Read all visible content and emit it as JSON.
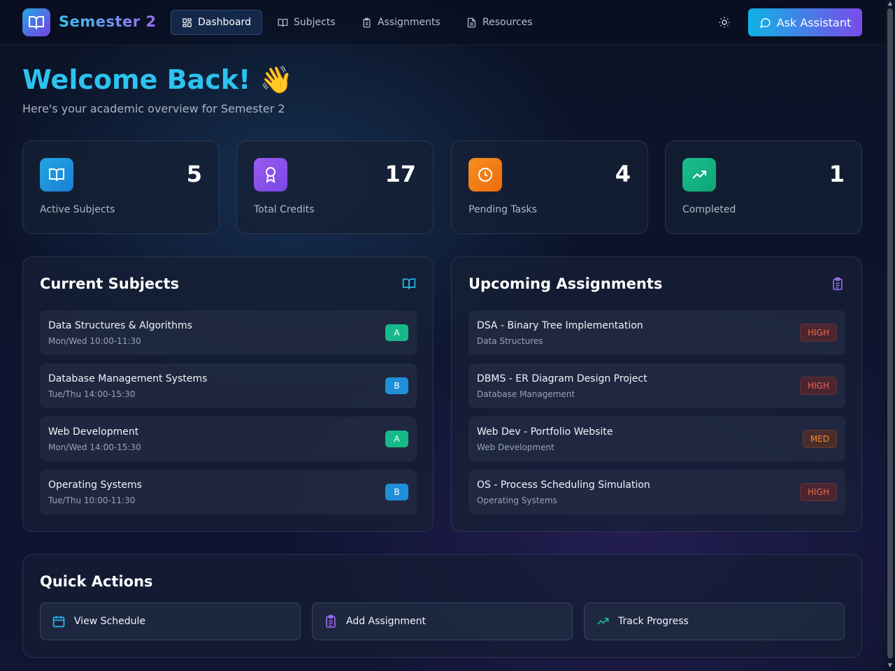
{
  "app": {
    "brand": "Semester 2",
    "ask_label": "Ask Assistant"
  },
  "nav": {
    "tabs": [
      {
        "label": "Dashboard",
        "icon": "dashboard-icon",
        "active": true
      },
      {
        "label": "Subjects",
        "icon": "book-icon",
        "active": false
      },
      {
        "label": "Assignments",
        "icon": "clipboard-icon",
        "active": false
      },
      {
        "label": "Resources",
        "icon": "file-icon",
        "active": false
      }
    ]
  },
  "header": {
    "welcome": "Welcome Back! 👋",
    "subtitle": "Here's your academic overview for Semester 2"
  },
  "stats": [
    {
      "value": "5",
      "label": "Active Subjects",
      "icon": "book-icon",
      "color": "#1fa0e0"
    },
    {
      "value": "17",
      "label": "Total Credits",
      "icon": "award-icon",
      "color": "#8b55ec"
    },
    {
      "value": "4",
      "label": "Pending Tasks",
      "icon": "clock-icon",
      "color": "#f07a12"
    },
    {
      "value": "1",
      "label": "Completed",
      "icon": "trending-up-icon",
      "color": "#12b07f"
    }
  ],
  "subjects": {
    "title": "Current Subjects",
    "items": [
      {
        "name": "Data Structures & Algorithms",
        "schedule": "Mon/Wed 10:00-11:30",
        "grade": "A"
      },
      {
        "name": "Database Management Systems",
        "schedule": "Tue/Thu 14:00-15:30",
        "grade": "B"
      },
      {
        "name": "Web Development",
        "schedule": "Mon/Wed 14:00-15:30",
        "grade": "A"
      },
      {
        "name": "Operating Systems",
        "schedule": "Tue/Thu 10:00-11:30",
        "grade": "B"
      }
    ]
  },
  "assignments": {
    "title": "Upcoming Assignments",
    "items": [
      {
        "name": "DSA - Binary Tree Implementation",
        "subject": "Data Structures",
        "priority": "HIGH"
      },
      {
        "name": "DBMS - ER Diagram Design Project",
        "subject": "Database Management",
        "priority": "HIGH"
      },
      {
        "name": "Web Dev - Portfolio Website",
        "subject": "Web Development",
        "priority": "MED"
      },
      {
        "name": "OS - Process Scheduling Simulation",
        "subject": "Operating Systems",
        "priority": "HIGH"
      }
    ]
  },
  "quick_actions": {
    "title": "Quick Actions",
    "items": [
      {
        "label": "View Schedule",
        "icon": "calendar-icon"
      },
      {
        "label": "Add Assignment",
        "icon": "clipboard-icon"
      },
      {
        "label": "Track Progress",
        "icon": "trending-up-icon"
      }
    ]
  },
  "colors": {
    "grade_a": "#16b98a",
    "grade_b": "#1f90d8",
    "high": "#f0644e",
    "med": "#f08a3a"
  }
}
